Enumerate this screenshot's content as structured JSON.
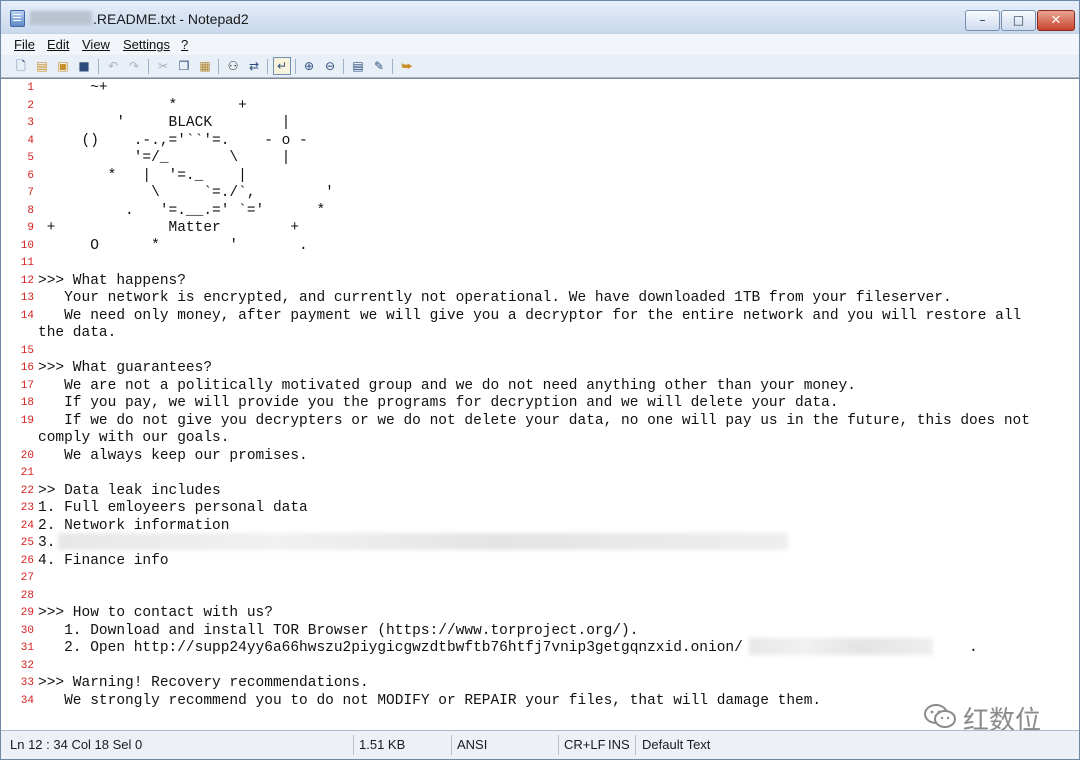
{
  "window": {
    "title": ".README.txt - Notepad2",
    "minimize_glyph": "–",
    "maximize_glyph": "□",
    "close_glyph": "✕"
  },
  "menu": {
    "items": [
      "File",
      "Edit",
      "View",
      "Settings",
      "?"
    ]
  },
  "toolbar": {
    "icons": [
      "new-icon",
      "open-icon",
      "browse-icon",
      "save-icon",
      "undo-icon",
      "redo-icon",
      "cut-icon",
      "copy-icon",
      "paste-icon",
      "find-icon",
      "replace-icon",
      "word-wrap-icon",
      "zoom-in-icon",
      "zoom-out-icon",
      "select-scheme-icon",
      "customize-scheme-icon",
      "exit-icon"
    ]
  },
  "editor": {
    "line_number_color": "#d41e1e",
    "lines": [
      {
        "n": "1",
        "text": "      ~+"
      },
      {
        "n": "2",
        "text": "               *       +"
      },
      {
        "n": "3",
        "text": "         '     BLACK        |"
      },
      {
        "n": "4",
        "text": "     ()    .-.,='``'=.    - o -"
      },
      {
        "n": "5",
        "text": "           '=/_       \\     |"
      },
      {
        "n": "6",
        "text": "        *   |  '=._    |"
      },
      {
        "n": "7",
        "text": "             \\     `=./`,        '"
      },
      {
        "n": "8",
        "text": "          .   '=.__.=' `='      *"
      },
      {
        "n": "9",
        "text": " +             Matter        +"
      },
      {
        "n": "10",
        "text": "      O      *        '       ."
      },
      {
        "n": "11",
        "text": ""
      },
      {
        "n": "12",
        "text": ">>> What happens?"
      },
      {
        "n": "13",
        "text": "   Your network is encrypted, and currently not operational. We have downloaded 1TB from your fileserver."
      },
      {
        "n": "14",
        "text": "   We need only money, after payment we will give you a decryptor for the entire network and you will restore all"
      },
      {
        "n": "",
        "text": "the data."
      },
      {
        "n": "15",
        "text": ""
      },
      {
        "n": "16",
        "text": ">>> What guarantees?"
      },
      {
        "n": "17",
        "text": "   We are not a politically motivated group and we do not need anything other than your money."
      },
      {
        "n": "18",
        "text": "   If you pay, we will provide you the programs for decryption and we will delete your data."
      },
      {
        "n": "19",
        "text": "   If we do not give you decrypters or we do not delete your data, no one will pay us in the future, this does not"
      },
      {
        "n": "",
        "text": "comply with our goals."
      },
      {
        "n": "20",
        "text": "   We always keep our promises."
      },
      {
        "n": "21",
        "text": ""
      },
      {
        "n": "22",
        "text": ">> Data leak includes"
      },
      {
        "n": "23",
        "text": "1. Full emloyeers personal data"
      },
      {
        "n": "24",
        "text": "2. Network information"
      },
      {
        "n": "25",
        "text": "3."
      },
      {
        "n": "26",
        "text": "4. Finance info"
      },
      {
        "n": "27",
        "text": ""
      },
      {
        "n": "28",
        "text": ""
      },
      {
        "n": "29",
        "text": ">>> How to contact with us?"
      },
      {
        "n": "30",
        "text": "   1. Download and install TOR Browser (https://www.torproject.org/)."
      },
      {
        "n": "31",
        "text": "   2. Open http://supp24yy6a66hwszu2piygicgwzdtbwftb76htfj7vnip3getgqnzxid.onion/                          ."
      },
      {
        "n": "32",
        "text": ""
      },
      {
        "n": "33",
        "text": ">>> Warning! Recovery recommendations."
      },
      {
        "n": "34",
        "text": "   We strongly recommend you to do not MODIFY or REPAIR your files, that will damage them."
      }
    ]
  },
  "watermark": {
    "text": "红数位",
    "icon": "wechat-icon"
  },
  "statusbar": {
    "position": "Ln 12 : 34   Col 18   Sel 0",
    "size": "1.51 KB",
    "encoding": "ANSI",
    "line_endings": "CR+LF",
    "insert_mode": "INS",
    "scheme": "Default Text"
  }
}
